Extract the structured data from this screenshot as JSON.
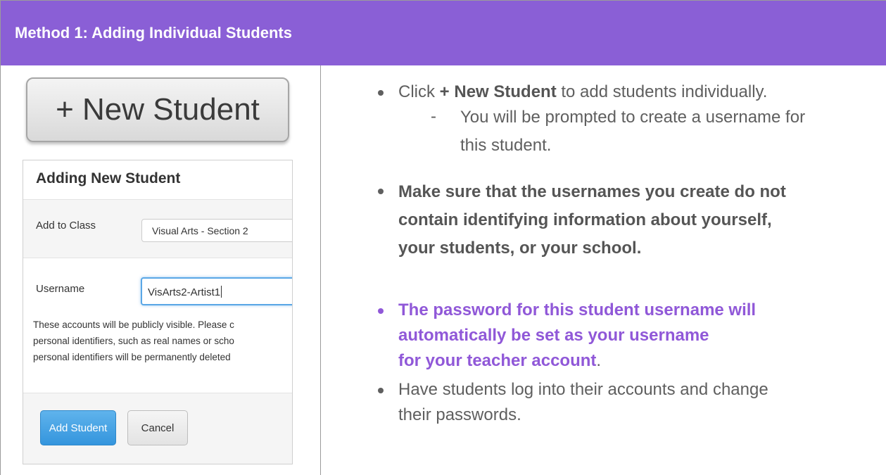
{
  "header": {
    "title": "Method 1: Adding Individual Students"
  },
  "left": {
    "new_student_button": "+ New Student",
    "dialog": {
      "title": "Adding New Student",
      "class_label": "Add to Class",
      "class_value": "Visual Arts - Section 2",
      "username_label": "Username",
      "username_value": "VisArts2-Artist1",
      "notice_lines": [
        "These accounts will be publicly visible. Please c",
        "personal identifiers, such as real names or scho",
        "personal identifiers will be permanently deleted"
      ],
      "add_button": "Add Student",
      "cancel_button": "Cancel"
    }
  },
  "instructions": {
    "b1_pre": "Click ",
    "b1_bold": "+ New Student",
    "b1_post": " to add students individually.",
    "b1_sub_line1": "You will be prompted to create a username for",
    "b1_sub_line2": "this student.",
    "b2_line1": "Make sure that the usernames you create do not",
    "b2_line2": "contain identifying information about yourself,",
    "b2_line3": "your students, or your school.",
    "b3_line1": "The password for this student username will",
    "b3_line2": "automatically be set as your username",
    "b3_line3": "for your teacher account",
    "b3_period": ".",
    "b4_line1": "Have students log into their accounts and change",
    "b4_line2": "their passwords."
  },
  "colors": {
    "header_bg": "#8a5fd6",
    "accent_purple": "#9058d8",
    "primary_button": "#3495dd"
  }
}
